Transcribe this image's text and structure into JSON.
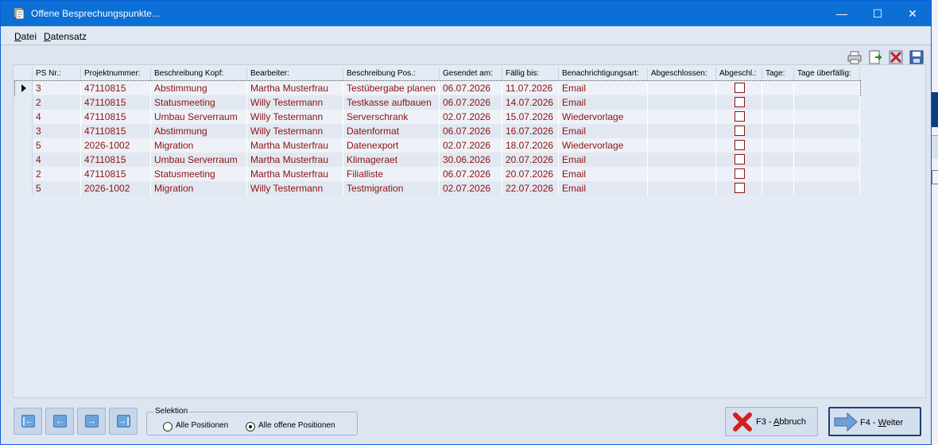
{
  "window": {
    "title": "Offene Besprechungspunkte...",
    "minimize": "—",
    "maximize": "☐",
    "close": "✕"
  },
  "menu": [
    {
      "key": "D",
      "rest": "atei"
    },
    {
      "key": "D",
      "rest": "atensatz"
    }
  ],
  "toolbar": [
    "print-icon",
    "export-icon",
    "delete-icon",
    "save-icon"
  ],
  "grid": {
    "columns": [
      "PS Nr.:",
      "Projektnummer:",
      "Beschreibung Kopf:",
      "Bearbeiter:",
      "Beschreibung Pos.:",
      "Gesendet am:",
      "Fällig bis:",
      "Benachrichtigungsart:",
      "Abgeschlossen:",
      "Abgeschl.:",
      "Tage:",
      "Tage überfällig:"
    ],
    "rows": [
      [
        "3",
        "47110815",
        "Abstimmung",
        "Martha Musterfrau",
        "Testübergabe planen",
        "06.07.2026",
        "11.07.2026",
        "Email",
        "",
        "",
        "",
        ""
      ],
      [
        "2",
        "47110815",
        "Statusmeeting",
        "Willy Testermann",
        "Testkasse aufbauen",
        "06.07.2026",
        "14.07.2026",
        "Email",
        "",
        "",
        "",
        ""
      ],
      [
        "4",
        "47110815",
        "Umbau Serverraum",
        "Willy Testermann",
        "Serverschrank",
        "02.07.2026",
        "15.07.2026",
        "Wiedervorlage",
        "",
        "",
        "",
        ""
      ],
      [
        "3",
        "47110815",
        "Abstimmung",
        "Willy Testermann",
        "Datenformat",
        "06.07.2026",
        "16.07.2026",
        "Email",
        "",
        "",
        "",
        ""
      ],
      [
        "5",
        "2026-1002",
        "Migration",
        "Martha Musterfrau",
        "Datenexport",
        "02.07.2026",
        "18.07.2026",
        "Wiedervorlage",
        "",
        "",
        "",
        ""
      ],
      [
        "4",
        "47110815",
        "Umbau Serverraum",
        "Martha Musterfrau",
        "Klimageraet",
        "30.06.2026",
        "20.07.2026",
        "Email",
        "",
        "",
        "",
        ""
      ],
      [
        "2",
        "47110815",
        "Statusmeeting",
        "Martha Musterfrau",
        "Filialliste",
        "06.07.2026",
        "20.07.2026",
        "Email",
        "",
        "",
        "",
        ""
      ],
      [
        "5",
        "2026-1002",
        "Migration",
        "Willy Testermann",
        "Testmigration",
        "02.07.2026",
        "22.07.2026",
        "Email",
        "",
        "",
        "",
        ""
      ]
    ],
    "abgeschl_checked": [
      false,
      false,
      false,
      false,
      false,
      false,
      false,
      false
    ],
    "selected_row": 0
  },
  "navigation": [
    "first-record-icon",
    "previous-record-icon",
    "next-record-icon",
    "last-record-icon"
  ],
  "navigation_glyphs": [
    "|←",
    "←",
    "→",
    "→|"
  ],
  "selektion": {
    "label": "Selektion",
    "options": [
      "Alle Positionen",
      "Alle offene Positionen"
    ],
    "selected": 1
  },
  "buttons": {
    "abbruch": {
      "prefix": "F3 - ",
      "key": "A",
      "rest": "bbruch"
    },
    "weiter": {
      "prefix": "F4 - ",
      "key": "W",
      "rest": "eiter"
    }
  }
}
